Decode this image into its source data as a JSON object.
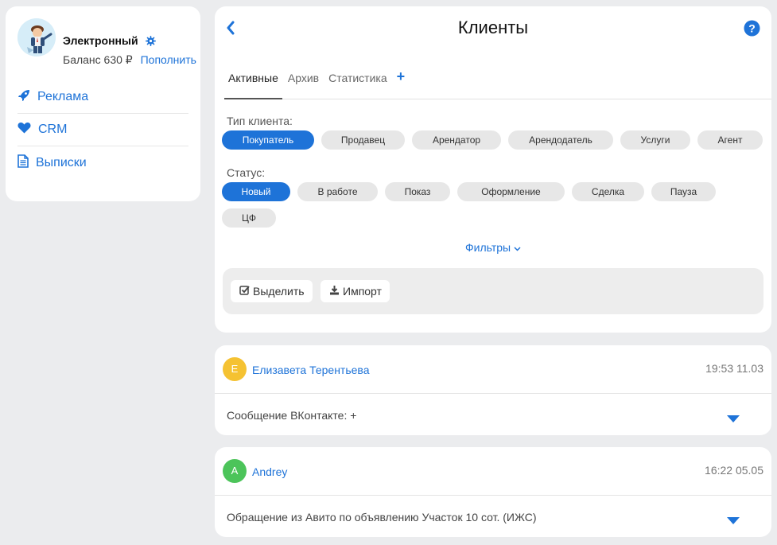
{
  "sidebar": {
    "profile": {
      "name": "Электронный",
      "balance": "Баланс 630 ₽",
      "topup": "Пополнить"
    },
    "items": [
      {
        "icon": "rocket-icon",
        "label": "Реклама"
      },
      {
        "icon": "heart-icon",
        "label": "CRM"
      },
      {
        "icon": "document-icon",
        "label": "Выписки"
      }
    ]
  },
  "header": {
    "title": "Клиенты"
  },
  "tabs": [
    {
      "label": "Активные",
      "active": true
    },
    {
      "label": "Архив"
    },
    {
      "label": "Статистика"
    },
    {
      "label": "+"
    }
  ],
  "client_type": {
    "label": "Тип клиента:",
    "options": [
      "Покупатель",
      "Продавец",
      "Арендатор",
      "Арендодатель",
      "Услуги",
      "Агент"
    ],
    "selected": "Покупатель"
  },
  "status": {
    "label": "Статус:",
    "options": [
      "Новый",
      "В работе",
      "Показ",
      "Оформление",
      "Сделка",
      "Пауза",
      "ЦФ"
    ],
    "selected": "Новый"
  },
  "filters_label": "Фильтры",
  "toolbar": {
    "select_label": "Выделить",
    "import_label": "Импорт"
  },
  "clients": [
    {
      "initial": "Е",
      "name": "Елизавета Терентьева",
      "time": "19:53 11.03",
      "message": "Сообщение ВКонтакте: +",
      "color": "#f5c232"
    },
    {
      "initial": "A",
      "name": "Andrey",
      "time": "16:22 05.05",
      "message": "Обращение из Авито по объявлению Участок 10 сот. (ИЖС)",
      "color": "#4cc45a"
    }
  ],
  "colors": {
    "accent": "#1e73d8",
    "background": "#ebecee"
  }
}
